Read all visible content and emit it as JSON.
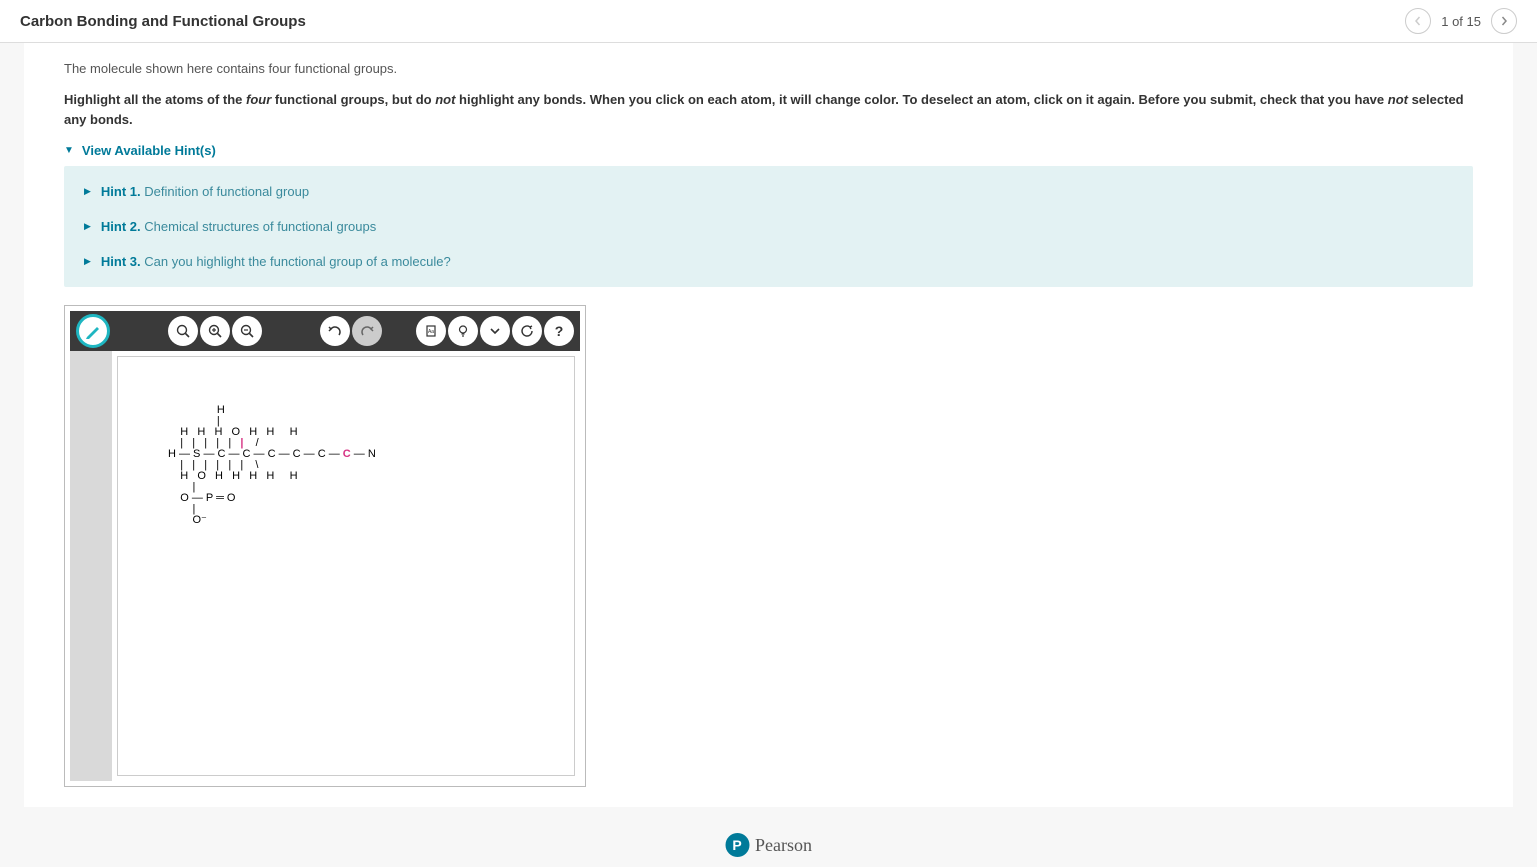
{
  "header": {
    "title": "Carbon Bonding and Functional Groups",
    "page_indicator": "1 of 15"
  },
  "intro": "The molecule shown here contains four functional groups.",
  "instruction": {
    "pre": "Highlight all the atoms of the ",
    "four": "four",
    "mid1": " functional groups, but do ",
    "not1": "not",
    "mid2": " highlight any bonds. When you click on each atom, it will change color. To deselect an atom, click on it again. Before you submit, check that you have ",
    "not2": "not",
    "post": " selected any bonds."
  },
  "hints": {
    "toggle_label": "View Available Hint(s)",
    "items": [
      {
        "label": "Hint 1.",
        "desc": "Definition of functional group"
      },
      {
        "label": "Hint 2.",
        "desc": "Chemical structures of functional groups"
      },
      {
        "label": "Hint 3.",
        "desc": "Can you highlight the functional group of a molecule?"
      }
    ]
  },
  "toolbar": {
    "marker": "marker-tool",
    "zoom_fit": "zoom-fit",
    "zoom_in": "zoom-in",
    "zoom_out": "zoom-out",
    "undo": "undo",
    "redo": "redo",
    "paste": "paste",
    "hint": "hint-light",
    "expand": "expand",
    "reset": "reset",
    "help": "help"
  },
  "molecule": {
    "line1": "                H",
    "line2": "                |",
    "line3": "    H   H   H   O   H   H     H",
    "line4": "    |   |   |   |   |   ",
    "line4_hl": "|",
    "line4_end": "    /",
    "line5": "H — S — C — C — C — C — C — ",
    "line5_hl": "C",
    "line5_end": " — N",
    "line6": "    |   |   |   |   |   |    \\",
    "line7": "    H   O   H   H   H   H     H",
    "line8": "        |",
    "line9": "    O — P ═ O",
    "line10": "        |",
    "line11": "        O⁻"
  },
  "footer": {
    "brand": "Pearson",
    "icon_text": "P"
  }
}
